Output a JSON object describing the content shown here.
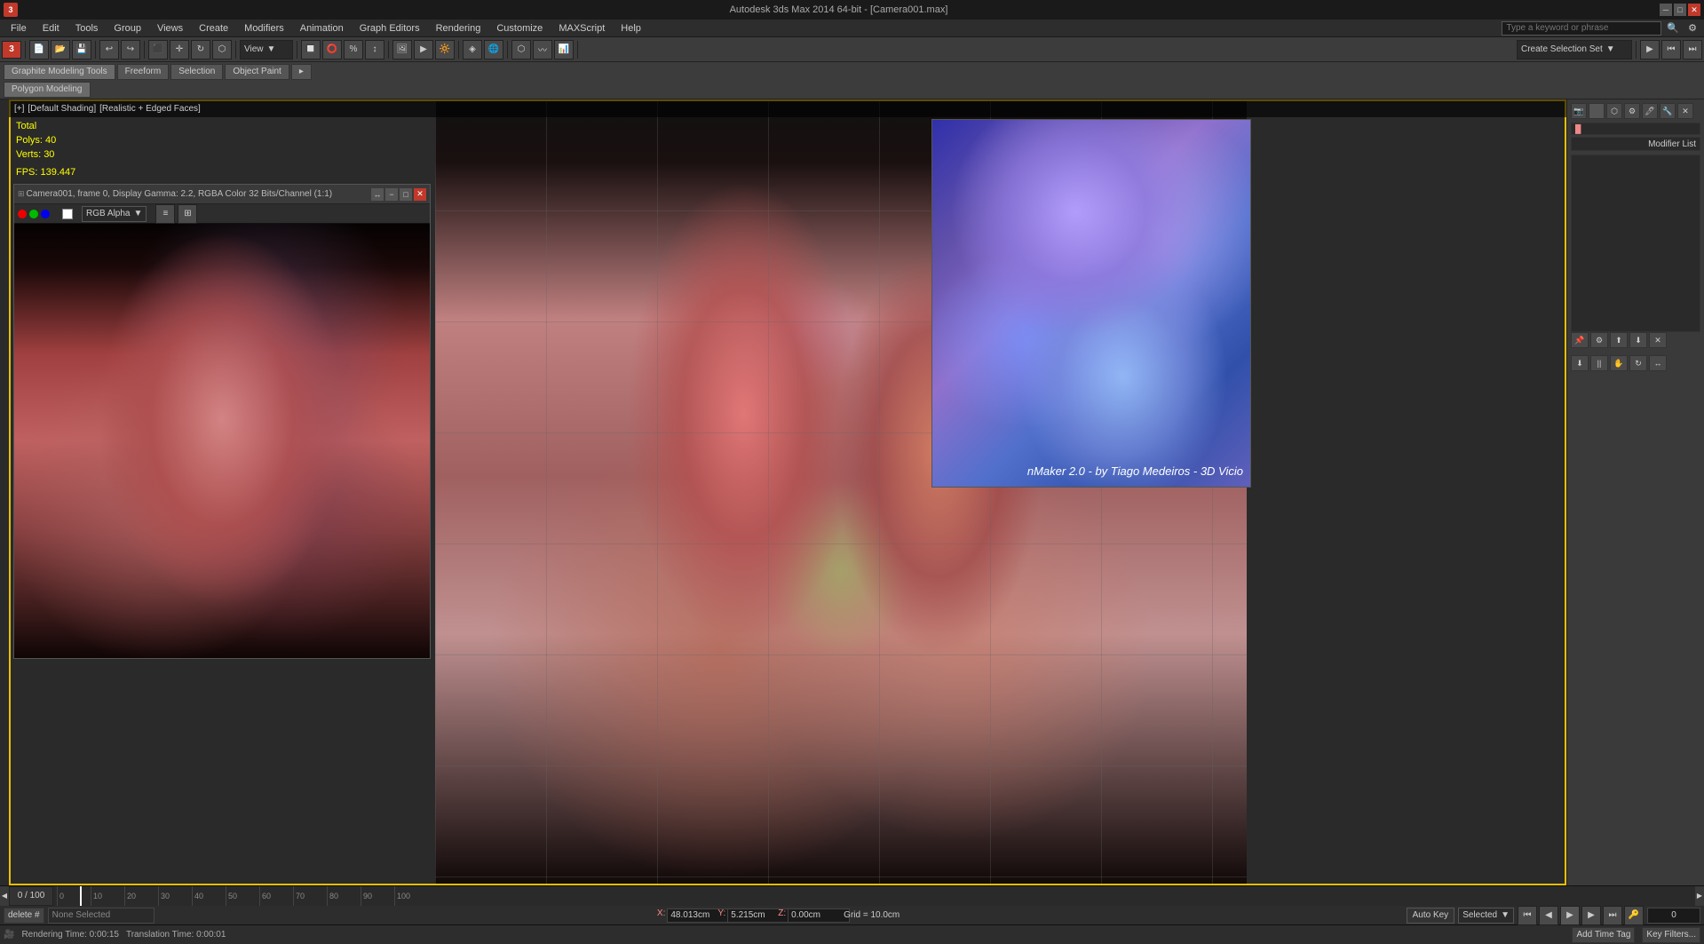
{
  "titlebar": {
    "app_icon": "3",
    "title": "Autodesk 3ds Max 2014 64-bit - [Camera001.max]",
    "minimize": "─",
    "maximize": "□",
    "close": "✕"
  },
  "menubar": {
    "items": [
      "File",
      "Edit",
      "Tools",
      "Group",
      "Views",
      "Create",
      "Modifiers",
      "Animation",
      "Graph Editors",
      "Rendering",
      "Customize",
      "MAXScript",
      "Help"
    ]
  },
  "toolbar": {
    "undo": "↩",
    "redo": "↪",
    "view_dropdown": "View",
    "create_selection_btn": "Create Selection Set",
    "search_placeholder": "Type a keyword or phrase"
  },
  "modeling_tabs": {
    "tab1": "Graphite Modeling Tools",
    "tab2": "Freeform",
    "tab3": "Selection",
    "tab4": "Object Paint",
    "subtab": "Polygon Modeling"
  },
  "viewport": {
    "label_parts": [
      "[+]",
      "[Default Shading]",
      "[Realistic + Edged Faces]"
    ],
    "stats": {
      "total_label": "Total",
      "polys_label": "Polys:",
      "polys_val": "40",
      "verts_label": "Verts:",
      "verts_val": "30",
      "fps_label": "FPS:",
      "fps_val": "139.447"
    }
  },
  "camera_window": {
    "title": "Camera001, frame 0, Display Gamma: 2.2, RGBA Color 32 Bits/Channel (1:1)",
    "scroll_icon": "↔",
    "minus_icon": "−",
    "maximize_icon": "□",
    "close_icon": "✕",
    "rgb_alpha_label": "RGB Alpha",
    "channel_btn": "≡",
    "second_btn": "⊞"
  },
  "normal_map": {
    "credit_text": "nMaker 2.0 - by Tiago Medeiros - 3D Vicio"
  },
  "right_panel": {
    "modifier_list_label": "Modifier List",
    "icon_buttons": [
      "📷",
      "🖊",
      "🔲",
      "🎨",
      "✕"
    ],
    "tool_buttons": [
      "⬇",
      "||",
      "✋",
      "↻",
      "↔"
    ]
  },
  "timeline": {
    "current_frame": "0",
    "total_frames": "100",
    "display": "0 / 100",
    "ticks": [
      "0",
      "10",
      "20",
      "30",
      "40",
      "50",
      "60",
      "70",
      "80",
      "90",
      "100"
    ]
  },
  "statusbar": {
    "delete_label": "delete #",
    "none_selected": "None Selected",
    "x_label": "X:",
    "x_val": "48.013cm",
    "y_label": "Y:",
    "y_val": "5.215cm",
    "z_label": "Z:",
    "z_val": "0.00cm",
    "grid_label": "Grid = 10.0cm",
    "auto_key": "Auto Key",
    "selected_label": "Selected",
    "key_filters": "Key Filters...",
    "add_time_tag": "Add Time Tag"
  },
  "bottom_bar": {
    "rendering_time": "Rendering Time: 0:00:15",
    "translation_time": "Translation Time: 0:00:01",
    "cam_icon": "🎥"
  }
}
